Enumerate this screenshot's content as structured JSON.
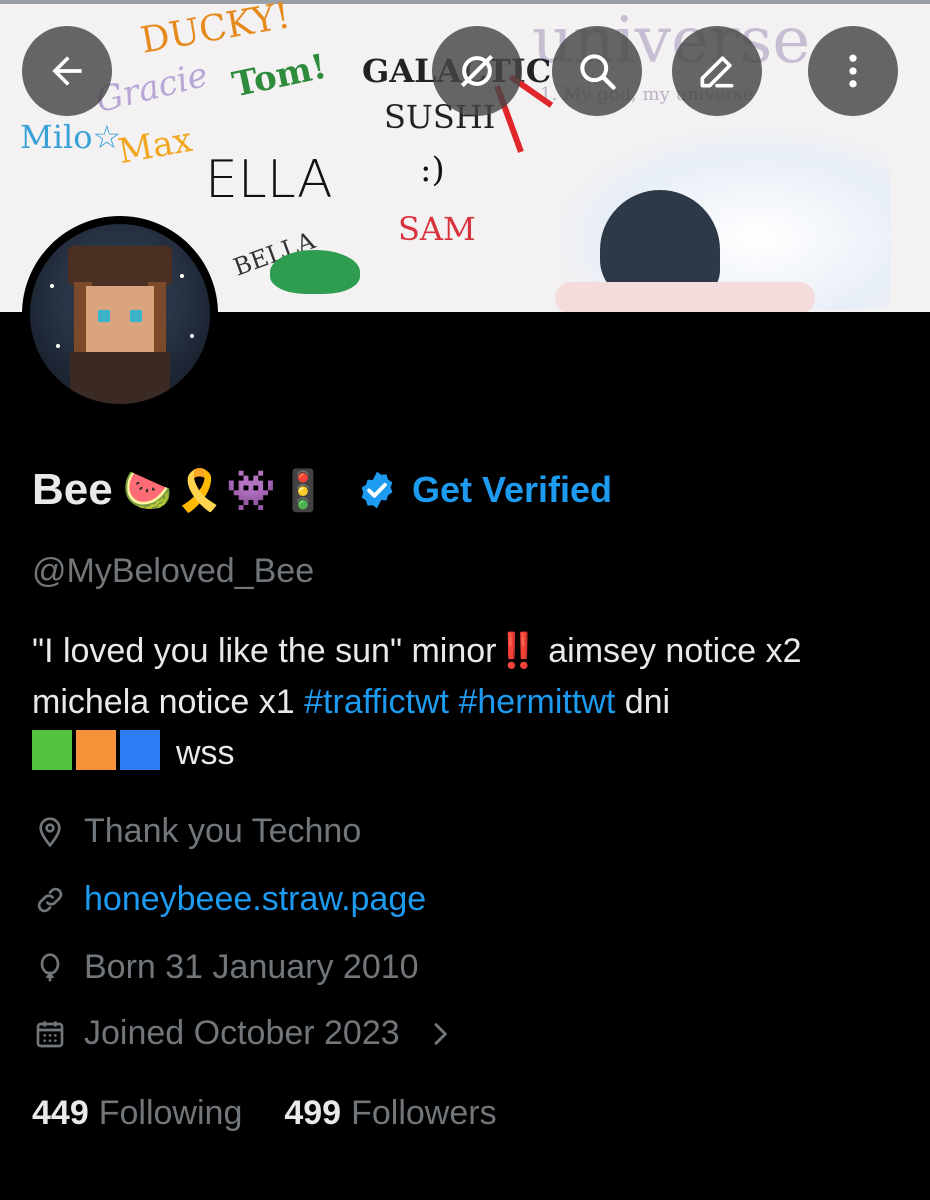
{
  "banner": {
    "scribbles": {
      "ducky": "DUCKY!",
      "gracie": "Gracie",
      "tom": "Tom!",
      "milo": "Milo☆",
      "max": "Max",
      "ella": "ELLA",
      "galactic": "GALACTIC",
      "sushi": "SUSHI",
      "smile": ":)",
      "sam": "SAM",
      "bella": "BELLA",
      "universe": "universe",
      "subtitle": "1. My god, my universe"
    }
  },
  "top_buttons": {
    "back": "arrow-left-icon",
    "grok": "grok-icon",
    "search": "search-icon",
    "edit": "edit-pencil-icon",
    "more": "more-vertical-icon"
  },
  "profile": {
    "name": "Bee",
    "name_emoji": "🍉🎗️👾🚦",
    "verified_label": "Get Verified",
    "handle": "@MyBeloved_Bee",
    "bio": {
      "part1": "\"I loved you like the sun\" minor",
      "bang": "‼️",
      "part2": " aimsey notice x2 michela notice x1 ",
      "tag1": "#traffictwt",
      "tag2": "#hermittwt",
      "part3": " dni",
      "part4": "wss"
    },
    "location": "Thank you Techno",
    "website": "honeybeee.straw.page",
    "birthday": "Born 31 January 2010",
    "joined": "Joined October 2023",
    "following_count": "449",
    "following_label": "Following",
    "followers_count": "499",
    "followers_label": "Followers"
  },
  "colors": {
    "background": "#000000",
    "primary_text": "#e7e9ea",
    "secondary_text": "#71767b",
    "accent": "#1d9bf0",
    "square_green": "#54c23f",
    "square_orange": "#f7923a",
    "square_blue": "#2d7cf5"
  }
}
